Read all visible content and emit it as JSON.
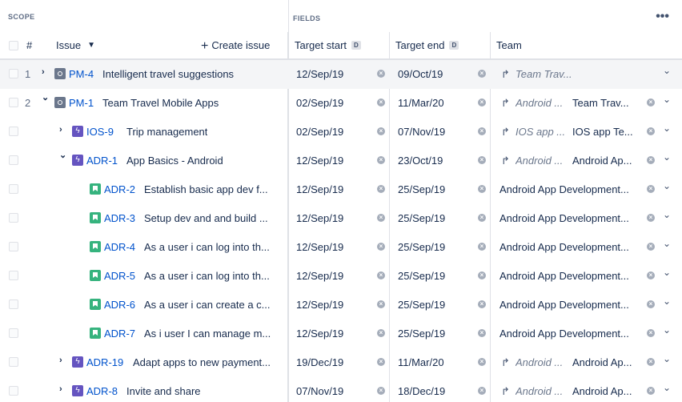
{
  "header": {
    "scope_label": "SCOPE",
    "fields_label": "FIELDS",
    "more": "•••"
  },
  "columns": {
    "hash": "#",
    "issue": "Issue",
    "create_issue": "Create issue",
    "target_start": "Target start",
    "target_end": "Target end",
    "date_badge": "D",
    "team": "Team"
  },
  "rows": [
    {
      "num": "1",
      "indent": 0,
      "expand": "right",
      "type": "epic",
      "key": "PM-4",
      "summary": "Intelligent travel suggestions",
      "start": "12/Sep/19",
      "end": "09/Oct/19",
      "team_inherited": "Team Trav...",
      "team": "",
      "clearable_team": false,
      "highlight": true
    },
    {
      "num": "2",
      "indent": 0,
      "expand": "down",
      "type": "epic",
      "key": "PM-1",
      "summary": "Team Travel Mobile Apps",
      "start": "02/Sep/19",
      "end": "11/Mar/20",
      "team_inherited": "Android ...",
      "team": "Team Trav...",
      "clearable_team": true,
      "highlight": false
    },
    {
      "num": "",
      "indent": 1,
      "expand": "right",
      "type": "bolt",
      "key": "IOS-9",
      "summary": "Trip management",
      "start": "02/Sep/19",
      "end": "07/Nov/19",
      "team_inherited": "IOS app ...",
      "team": "IOS app Te...",
      "clearable_team": true,
      "highlight": false
    },
    {
      "num": "",
      "indent": 1,
      "expand": "down",
      "type": "bolt",
      "key": "ADR-1",
      "summary": "App Basics - Android",
      "start": "12/Sep/19",
      "end": "23/Oct/19",
      "team_inherited": "Android ...",
      "team": "Android Ap...",
      "clearable_team": true,
      "highlight": false
    },
    {
      "num": "",
      "indent": 2,
      "expand": "",
      "type": "story",
      "key": "ADR-2",
      "summary": "Establish basic app dev f...",
      "start": "12/Sep/19",
      "end": "25/Sep/19",
      "team_inherited": "",
      "team": "Android App Development...",
      "clearable_team": true,
      "highlight": false
    },
    {
      "num": "",
      "indent": 2,
      "expand": "",
      "type": "story",
      "key": "ADR-3",
      "summary": "Setup dev and and build ...",
      "start": "12/Sep/19",
      "end": "25/Sep/19",
      "team_inherited": "",
      "team": "Android App Development...",
      "clearable_team": true,
      "highlight": false
    },
    {
      "num": "",
      "indent": 2,
      "expand": "",
      "type": "story",
      "key": "ADR-4",
      "summary": "As a user i can log into th...",
      "start": "12/Sep/19",
      "end": "25/Sep/19",
      "team_inherited": "",
      "team": "Android App Development...",
      "clearable_team": true,
      "highlight": false
    },
    {
      "num": "",
      "indent": 2,
      "expand": "",
      "type": "story",
      "key": "ADR-5",
      "summary": "As a user i can log into th...",
      "start": "12/Sep/19",
      "end": "25/Sep/19",
      "team_inherited": "",
      "team": "Android App Development...",
      "clearable_team": true,
      "highlight": false
    },
    {
      "num": "",
      "indent": 2,
      "expand": "",
      "type": "story",
      "key": "ADR-6",
      "summary": "As a user i can create a c...",
      "start": "12/Sep/19",
      "end": "25/Sep/19",
      "team_inherited": "",
      "team": "Android App Development...",
      "clearable_team": true,
      "highlight": false
    },
    {
      "num": "",
      "indent": 2,
      "expand": "",
      "type": "story",
      "key": "ADR-7",
      "summary": "As i user I can manage m...",
      "start": "12/Sep/19",
      "end": "25/Sep/19",
      "team_inherited": "",
      "team": "Android App Development...",
      "clearable_team": true,
      "highlight": false
    },
    {
      "num": "",
      "indent": 1,
      "expand": "right",
      "type": "bolt",
      "key": "ADR-19",
      "summary": "Adapt apps to new payment...",
      "start": "19/Dec/19",
      "end": "11/Mar/20",
      "team_inherited": "Android ...",
      "team": "Android Ap...",
      "clearable_team": true,
      "highlight": false
    },
    {
      "num": "",
      "indent": 1,
      "expand": "right",
      "type": "bolt",
      "key": "ADR-8",
      "summary": "Invite and share",
      "start": "07/Nov/19",
      "end": "18/Dec/19",
      "team_inherited": "Android ...",
      "team": "Android Ap...",
      "clearable_team": true,
      "highlight": false
    }
  ],
  "icons": {
    "expand_right": "›",
    "expand_down": "⌄",
    "clear": "×",
    "dropdown": "⌄",
    "inherit_arrow": "↱",
    "bolt": "ϟ"
  },
  "colors": {
    "link": "#0052cc",
    "epic": "#6b778c",
    "subepic": "#6554c0",
    "story": "#36b37e"
  }
}
